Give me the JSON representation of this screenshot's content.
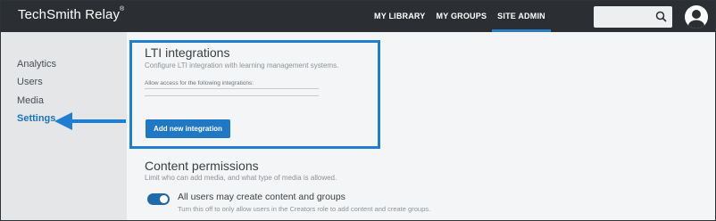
{
  "header": {
    "brand": "TechSmith Relay",
    "brand_mark": "®",
    "nav": [
      {
        "label": "MY LIBRARY",
        "active": false
      },
      {
        "label": "MY GROUPS",
        "active": false
      },
      {
        "label": "SITE ADMIN",
        "active": true
      }
    ],
    "search_icon": "search-icon",
    "avatar_icon": "user-avatar-icon"
  },
  "sidebar": {
    "items": [
      {
        "label": "Analytics",
        "active": false
      },
      {
        "label": "Users",
        "active": false
      },
      {
        "label": "Media",
        "active": false
      },
      {
        "label": "Settings",
        "active": true
      }
    ]
  },
  "lti": {
    "title": "LTI integrations",
    "description": "Configure LTI integration with learning management systems.",
    "field_label": "Allow access for the following integrations:",
    "add_button": "Add new integration"
  },
  "content_permissions": {
    "title": "Content permissions",
    "description": "Limit who can add media, and what type of media is allowed.",
    "toggle_label": "All users may create content and groups",
    "toggle_description": "Turn this off to only allow users in the Creators role to add content and create groups.",
    "toggle_on": true
  },
  "colors": {
    "accent": "#1e7ecf",
    "topbar": "#2b2f33",
    "button": "#1f78c4"
  }
}
